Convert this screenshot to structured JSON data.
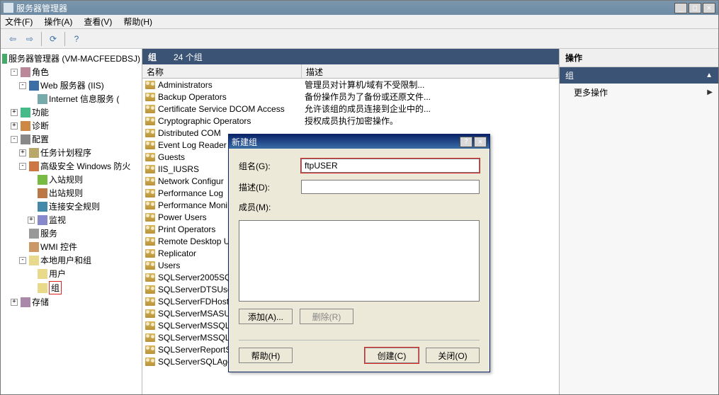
{
  "window": {
    "title": "服务器管理器",
    "menu": {
      "file": "文件(F)",
      "action": "操作(A)",
      "view": "查看(V)",
      "help": "帮助(H)"
    }
  },
  "tree": {
    "root": "服务器管理器 (VM-MACFEEDBSJ)",
    "roles": "角色",
    "web": "Web 服务器 (IIS)",
    "iis": "Internet 信息服务 (",
    "features": "功能",
    "diagnostics": "诊断",
    "config": "配置",
    "task": "任务计划程序",
    "fw": "高级安全 Windows 防火",
    "inbound": "入站规则",
    "outbound": "出站规则",
    "consec": "连接安全规则",
    "monitor": "监视",
    "services": "服务",
    "wmi": "WMI 控件",
    "localug": "本地用户和组",
    "users": "用户",
    "groups": "组",
    "storage": "存储"
  },
  "center": {
    "title": "组",
    "count": "24 个组",
    "col_name": "名称",
    "col_desc": "描述",
    "rows": [
      {
        "n": "Administrators",
        "d": "管理员对计算机/域有不受限制..."
      },
      {
        "n": "Backup Operators",
        "d": "备份操作员为了备份或还原文件..."
      },
      {
        "n": "Certificate Service DCOM Access",
        "d": "允许该组的成员连接到企业中的..."
      },
      {
        "n": "Cryptographic Operators",
        "d": "授权成员执行加密操作。"
      },
      {
        "n": "Distributed COM",
        "d": ""
      },
      {
        "n": "Event Log Reader",
        "d": ""
      },
      {
        "n": "Guests",
        "d": ""
      },
      {
        "n": "IIS_IUSRS",
        "d": ""
      },
      {
        "n": "Network Configur",
        "d": ""
      },
      {
        "n": "Performance Log",
        "d": ""
      },
      {
        "n": "Performance Moni",
        "d": ""
      },
      {
        "n": "Power Users",
        "d": ""
      },
      {
        "n": "Print Operators",
        "d": ""
      },
      {
        "n": "Remote Desktop U",
        "d": ""
      },
      {
        "n": "Replicator",
        "d": ""
      },
      {
        "n": "Users",
        "d": ""
      },
      {
        "n": "SQLServer2005SQL",
        "d": ""
      },
      {
        "n": "SQLServerDTSUser",
        "d": ""
      },
      {
        "n": "SQLServerFDHostU",
        "d": ""
      },
      {
        "n": "SQLServerMSASUse",
        "d": ""
      },
      {
        "n": "SQLServerMSSQLSe",
        "d": ""
      },
      {
        "n": "SQLServerMSSQLUs",
        "d": ""
      },
      {
        "n": "SQLServerReportS",
        "d": ""
      },
      {
        "n": "SQLServerSQLAgen",
        "d": ""
      }
    ]
  },
  "actions": {
    "title": "操作",
    "group": "组",
    "more": "更多操作"
  },
  "dialog": {
    "title": "新建组",
    "groupname_label": "组名(G):",
    "groupname_value": "ftpUSER",
    "desc_label": "描述(D):",
    "desc_value": "",
    "members_label": "成员(M):",
    "add": "添加(A)...",
    "remove": "删除(R)",
    "help": "帮助(H)",
    "create": "创建(C)",
    "close": "关闭(O)"
  }
}
